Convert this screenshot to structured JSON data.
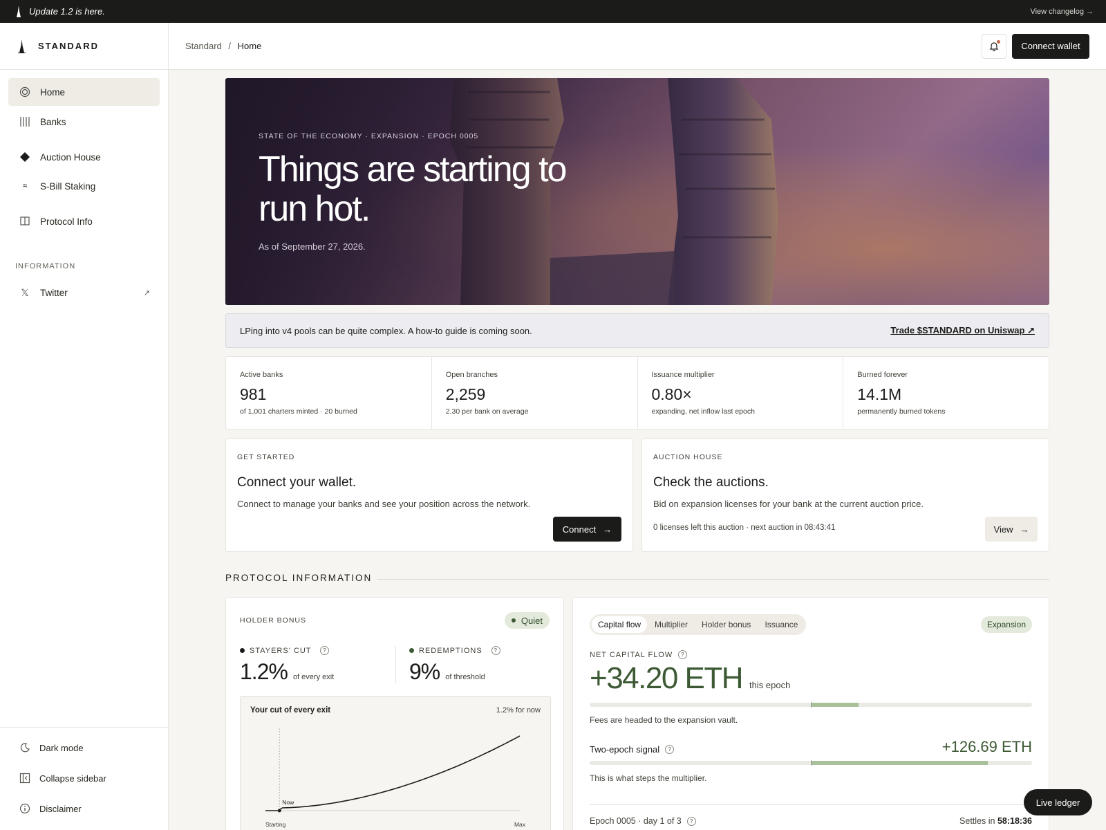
{
  "topbar": {
    "announcement": "Update 1.2 is here.",
    "changelog_link": "View changelog →"
  },
  "brand": {
    "name": "STANDARD"
  },
  "sidebar": {
    "items": [
      {
        "label": "Home",
        "icon": "circle-icon",
        "active": true
      },
      {
        "label": "Banks",
        "icon": "bars-icon"
      },
      {
        "label": "Auction House",
        "icon": "diamond-icon"
      },
      {
        "label": "S-Bill Staking",
        "icon": "approx-icon"
      },
      {
        "label": "Protocol Info",
        "icon": "book-icon"
      }
    ],
    "section_label": "INFORMATION",
    "twitter": {
      "label": "Twitter",
      "icon": "x-icon",
      "external": "↗"
    },
    "bottom": {
      "dark_mode": "Dark mode",
      "collapse": "Collapse sidebar",
      "disclaimer": "Disclaimer"
    }
  },
  "header": {
    "crumb_root": "Standard",
    "crumb_sep": "/",
    "crumb_current": "Home",
    "connect_wallet": "Connect wallet"
  },
  "hero": {
    "eyebrow": "STATE OF THE ECONOMY · EXPANSION · EPOCH 0005",
    "title": "Things are starting to run hot.",
    "as_of": "As of September 27, 2026."
  },
  "notice": {
    "text": "LPing into v4 pools can be quite complex. A how-to guide is coming soon.",
    "link": "Trade $STANDARD on Uniswap ↗"
  },
  "stats": [
    {
      "label": "Active banks",
      "value": "981",
      "sub": "of 1,001 charters minted · 20 burned"
    },
    {
      "label": "Open branches",
      "value": "2,259",
      "sub": "2.30 per bank on average"
    },
    {
      "label": "Issuance multiplier",
      "value": "0.80×",
      "sub": "expanding, net inflow last epoch"
    },
    {
      "label": "Burned forever",
      "value": "14.1M",
      "sub": "permanently burned tokens"
    }
  ],
  "get_started": {
    "eyebrow": "GET STARTED",
    "title": "Connect your wallet.",
    "text": "Connect to manage your banks and see your position across the network.",
    "button": "Connect",
    "arrow": "→"
  },
  "auction": {
    "eyebrow": "AUCTION HOUSE",
    "title": "Check the auctions.",
    "text": "Bid on expansion licenses for your bank at the current auction price.",
    "footnote": "0 licenses left this auction · next auction in 08:43:41",
    "button": "View",
    "arrow": "→"
  },
  "protocol": {
    "section_title": "PROTOCOL INFORMATION"
  },
  "holder_bonus": {
    "eyebrow": "HOLDER BONUS",
    "status": "Quiet",
    "stayers_label": "STAYERS' CUT",
    "stayers_value": "1.2%",
    "stayers_unit": "of every exit",
    "redemptions_label": "REDEMPTIONS",
    "redemptions_value": "9%",
    "redemptions_unit": "of threshold",
    "chart_title": "Your cut of every exit",
    "chart_note": "1.2% for now",
    "now_label": "Now",
    "x_start": "Starting",
    "x_end": "Max",
    "now_fraction": 0.055
  },
  "capital": {
    "tabs": [
      "Capital flow",
      "Multiplier",
      "Holder bonus",
      "Issuance"
    ],
    "phase": "Expansion",
    "net_label": "NET CAPITAL FLOW",
    "net_value": "+34.20 ETH",
    "net_unit": "this epoch",
    "net_caption": "Fees are headed to the expansion vault.",
    "signal_label": "Two-epoch signal",
    "signal_value": "+126.69 ETH",
    "signal_caption": "This is what steps the multiplier.",
    "epoch": "Epoch 0005 · day 1 of 3",
    "settles_label": "Settles in",
    "settles_value": "58:18:36"
  },
  "live_ledger": "Live ledger",
  "colors": {
    "accent_green": "#3d5a34",
    "bar_green": "#a8c19a",
    "pill_green": "#e3eadc"
  }
}
